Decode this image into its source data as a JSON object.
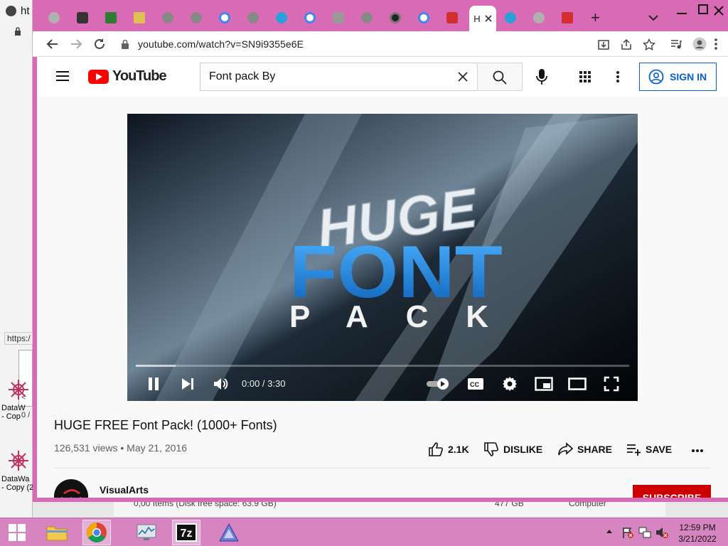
{
  "background_window": {
    "title_partial": "ht",
    "status_partial": "https:/",
    "scroll_arrow": "<",
    "count_partial": "0 /"
  },
  "desktop_icons": [
    {
      "label": "DataW",
      "sublabel": "- Cop"
    },
    {
      "label": "DataWa",
      "sublabel": "- Copy (2)"
    }
  ],
  "explorer_strip": {
    "items_text": "0,00 Items (Disk free space: 63.9 GB)",
    "size_text": "477 GB",
    "location_text": "Computer"
  },
  "browser": {
    "active_tab_label": "H",
    "new_tab_label": "+",
    "url": "youtube.com/watch?v=SN9i9355e6E",
    "tab_icons": [
      "globe-icon",
      "box-icon",
      "sheet-icon",
      "file-icon",
      "globe-icon",
      "globe-icon",
      "google-icon",
      "globe-icon",
      "telegram-icon",
      "google-icon",
      "puzzle-icon",
      "globe-icon",
      "chrome-icon",
      "google-icon",
      "pdf-icon",
      "telegram-icon",
      "globe-icon",
      "red-app-icon"
    ]
  },
  "youtube": {
    "logo_text": "YouTube",
    "search_value": "Font pack By",
    "signin_label": "SIGN IN",
    "player": {
      "time": "0:00 / 3:30",
      "played_fraction": 0.0,
      "buffered_fraction": 0.08,
      "thumbnail_line1": "HUGE",
      "thumbnail_line2": "FONT",
      "thumbnail_line3": "PACK"
    },
    "video": {
      "title": "HUGE FREE Font Pack! (1000+ Fonts)",
      "meta": "126,531 views • May 21, 2016"
    },
    "actions": {
      "likes": "2.1K",
      "dislike": "DISLIKE",
      "share": "SHARE",
      "save": "SAVE"
    },
    "channel": {
      "name": "VisualArts",
      "subscribe_label": "SUBSCRIBE"
    }
  },
  "taskbar": {
    "time": "12:59 PM",
    "date": "3/21/2022",
    "seven_zip_label": "7z"
  },
  "colors": {
    "chrome_frame": "#d96bb6",
    "taskbar": "#d785c1",
    "youtube_red": "#ff0000",
    "link_blue": "#065fd4",
    "font_blue": "#1e88e5"
  }
}
